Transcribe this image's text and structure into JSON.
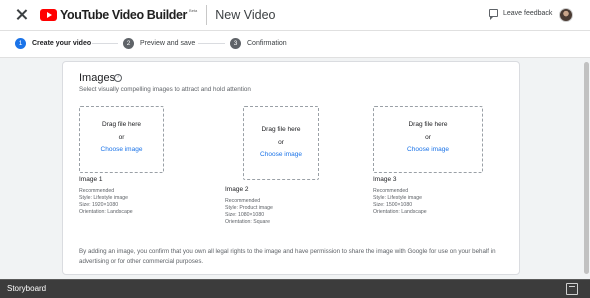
{
  "header": {
    "brand": "YouTube Video Builder",
    "beta": "Beta",
    "title": "New Video",
    "feedback": "Leave feedback"
  },
  "steps": [
    {
      "num": "1",
      "label": "Create your video"
    },
    {
      "num": "2",
      "label": "Preview and save"
    },
    {
      "num": "3",
      "label": "Confirmation"
    }
  ],
  "images_section": {
    "title": "Images",
    "help": "?",
    "subtitle": "Select visually compelling images to attract and hold attention",
    "drop": {
      "drag": "Drag file here",
      "or": "or",
      "choose": "Choose image"
    },
    "slots": [
      {
        "title": "Image 1",
        "recommended": "Recommended",
        "style": "Style: Lifestyle image",
        "size": "Size: 1920×1080",
        "orientation": "Orientation: Landscape"
      },
      {
        "title": "Image 2",
        "recommended": "Recommended",
        "style": "Style: Product image",
        "size": "Size: 1080×1080",
        "orientation": "Orientation: Square"
      },
      {
        "title": "Image 3",
        "recommended": "Recommended",
        "style": "Style: Lifestyle image",
        "size": "Size: 1500×1080",
        "orientation": "Orientation: Landscape"
      }
    ],
    "legal": "By adding an image, you confirm that you own all legal rights to the image and have permission to share the image with Google for use on your behalf in advertising or for other commercial purposes."
  },
  "bottom": {
    "label": "Storyboard"
  },
  "colors": {
    "accent": "#1a73e8",
    "brand_red": "#ff0000",
    "storyboard_bar": "#3c3c3c"
  }
}
